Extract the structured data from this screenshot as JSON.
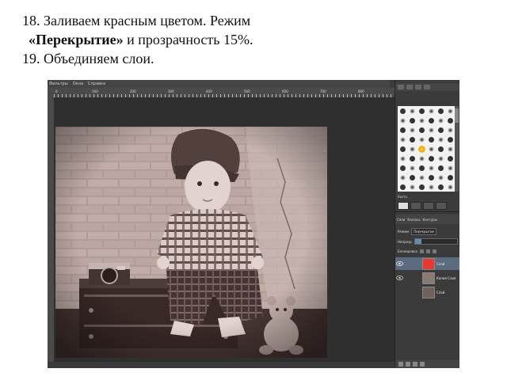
{
  "caption": {
    "line1": "18. Заливаем красным цветом. Режим",
    "line2_bold": "«Перекрытие»",
    "line2_rest": " и прозрачность 15%.",
    "line3": "19. Объединяем слои."
  },
  "app": {
    "menu": [
      "Фильтры",
      "Окна",
      "Справка"
    ],
    "ruler_ticks": [
      "0",
      "100",
      "200",
      "300",
      "400",
      "500",
      "600",
      "700",
      "800"
    ],
    "brushes": {
      "label": "Кисть",
      "selected_index": 26
    },
    "layers": {
      "tabs": [
        "Слои",
        "Каналы",
        "Контуры"
      ],
      "mode_label": "Режим",
      "mode_value": "Перекрытие",
      "opacity_label": "Непрозр.",
      "opacity_percent": 15,
      "lock_label": "Блокировка",
      "items": [
        {
          "name": "Слой",
          "color": "#e53935",
          "active": true
        },
        {
          "name": "Копия Слоя",
          "color": "#8a7a74",
          "active": false
        },
        {
          "name": "Слой",
          "color": "#6f625d",
          "active": false
        }
      ]
    }
  }
}
